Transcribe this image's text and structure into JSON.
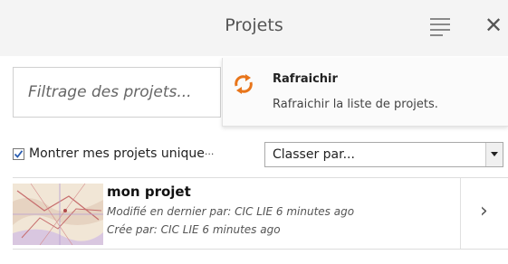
{
  "header": {
    "title": "Projets",
    "menu_icon": "hamburger-icon",
    "close_icon": "close-icon",
    "close_glyph": "✕"
  },
  "filter": {
    "placeholder": "Filtrage des projets..."
  },
  "tooltip": {
    "icon": "refresh-icon",
    "title": "Rafraichir",
    "description": "Rafraichir la liste de projets."
  },
  "options": {
    "only_mine_label": "Montrer mes projets unique",
    "only_mine_ellipsis": "···",
    "only_mine_checked": true,
    "sort_selected": "Classer par..."
  },
  "projects": [
    {
      "name": "mon projet",
      "modified": "Modifié en dernier par: CIC LIE 6 minutes ago",
      "created": "Crée par: CIC LIE 6 minutes ago",
      "open_glyph": "›"
    }
  ],
  "colors": {
    "accent_orange": "#e8751a",
    "checkbox_blue": "#2a5db0",
    "header_bg": "#f4f4f4"
  }
}
